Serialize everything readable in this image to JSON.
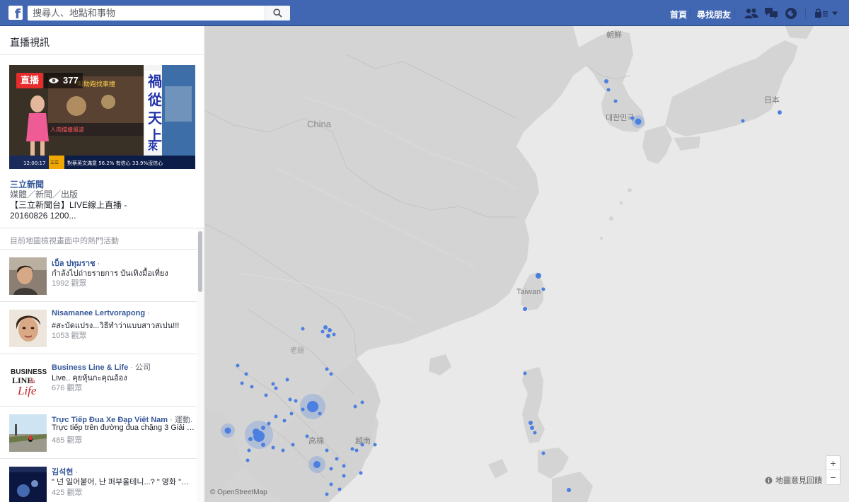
{
  "topbar": {
    "search_placeholder": "搜尋人、地點和事物",
    "nav_home": "首頁",
    "nav_find_friends": "尋找朋友",
    "brand_color": "#4267b2",
    "icons": [
      "friend-requests-icon",
      "messages-icon",
      "notifications-icon",
      "privacy-shortcuts-icon",
      "account-menu-icon"
    ]
  },
  "sidebar": {
    "title": "直播視訊",
    "featured": {
      "live_label": "直播",
      "viewer_count": "377",
      "name": "三立新聞",
      "category": "媒體／新聞／出版",
      "description_line1": "【三立新聞台】LIVE線上直播 -",
      "description_line2": "20160826 1200..."
    },
    "section_label": "目前地圖檢視畫面中的熱門活動",
    "items": [
      {
        "name": "เบ็ล ปทุมราช",
        "suffix": " ·",
        "desc": "กำลังไปถ่ายรายการ บันเทิงมื้อเที่ยง",
        "viewers": "1992 觀眾"
      },
      {
        "name": "Nisamanee Lertvorapong",
        "suffix": " ·",
        "desc": "#สะบัดแปรง...วิธีทำว่าแบบสาวสเปน!!!",
        "viewers": "1053 觀眾"
      },
      {
        "name": "Business Line & Life",
        "suffix": " · 公司",
        "desc": "Live.. คุยหุ้นกะคุณอ้อง",
        "viewers": "676 觀眾"
      },
      {
        "name": "Trực Tiếp Đua Xe Đạp Việt Nam",
        "suffix": " · 運動...",
        "desc": "Trực tiếp trên đường đua chặng 3 Giải đ...",
        "viewers": "485 觀眾"
      },
      {
        "name": "김석현",
        "suffix": " ·",
        "desc": "\" 넌 일어붙어, 난 퍼부울테니...? \" 영화 \"거룩...",
        "viewers": "425 觀眾"
      }
    ]
  },
  "map": {
    "labels": {
      "china": "China",
      "north_korea": "朝鮮",
      "south_korea": "대한민국",
      "japan": "日本",
      "taiwan": "Taiwan",
      "laos": "老撾",
      "cambodia": "高棉",
      "vietnam": "越南"
    },
    "attribution": "© OpenStreetMap",
    "feedback": "地圖意見回饋",
    "zoom_in": "+",
    "zoom_out": "−",
    "dot_color": "#4b7fe0"
  }
}
